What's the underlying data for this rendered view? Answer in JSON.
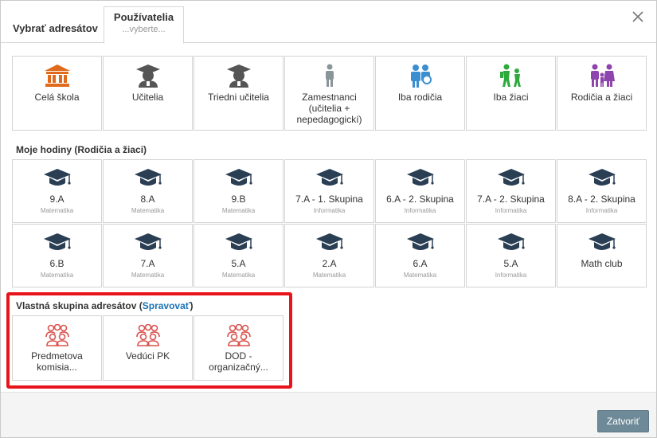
{
  "header": {
    "tab_select": "Vybrať adresátov",
    "tab_users": "Používatelia",
    "tab_users_sub": "...vyberte..."
  },
  "audience": [
    {
      "label": "Celá škola",
      "icon": "school-building-icon",
      "color": "#e06a1c"
    },
    {
      "label": "Učitelia",
      "icon": "teacher-icon",
      "color": "#555555"
    },
    {
      "label": "Triedni učitelia",
      "icon": "class-teacher-icon",
      "color": "#555555"
    },
    {
      "label": "Zamestnanci (učitelia + nepedagogickí)",
      "icon": "employee-icon",
      "color": "#8a9599"
    },
    {
      "label": "Iba rodičia",
      "icon": "parents-icon",
      "color": "#3b8fd0"
    },
    {
      "label": "Iba žiaci",
      "icon": "students-icon",
      "color": "#2eaa3d"
    },
    {
      "label": "Rodičia a žiaci",
      "icon": "family-icon",
      "color": "#8e44ad"
    }
  ],
  "classes_section": {
    "title": "Moje hodiny (Rodičia a žiaci)"
  },
  "classes_row1": [
    {
      "label": "9.A",
      "sub": "Matematika"
    },
    {
      "label": "8.A",
      "sub": "Matematika"
    },
    {
      "label": "9.B",
      "sub": "Matematika"
    },
    {
      "label": "7.A - 1. Skupina",
      "sub": "Informatika"
    },
    {
      "label": "6.A - 2. Skupina",
      "sub": "Informatika"
    },
    {
      "label": "7.A - 2. Skupina",
      "sub": "Informatika"
    },
    {
      "label": "8.A - 2. Skupina",
      "sub": "Informatika"
    }
  ],
  "classes_row2": [
    {
      "label": "6.B",
      "sub": "Matematika"
    },
    {
      "label": "7.A",
      "sub": "Matematika"
    },
    {
      "label": "5.A",
      "sub": "Matematika"
    },
    {
      "label": "2.A",
      "sub": "Matematika"
    },
    {
      "label": "6.A",
      "sub": "Matematika"
    },
    {
      "label": "5.A",
      "sub": "Informatika"
    },
    {
      "label": "Math club",
      "sub": ""
    }
  ],
  "groups_section": {
    "title": "Vlastná skupina adresátov (",
    "manage_link": "Spravovať",
    "title_end": ")"
  },
  "groups": [
    {
      "label": "Predmetova komisia..."
    },
    {
      "label": "Vedúci PK"
    },
    {
      "label": "DOD - organizačný..."
    }
  ],
  "footer": {
    "close_label": "Zatvoriť"
  },
  "colors": {
    "accent_link": "#1a73b5",
    "group_icon": "#d9534f",
    "cap_icon": "#2a3f54",
    "highlight": "#e8141c",
    "close_button": "#6e8a98"
  }
}
